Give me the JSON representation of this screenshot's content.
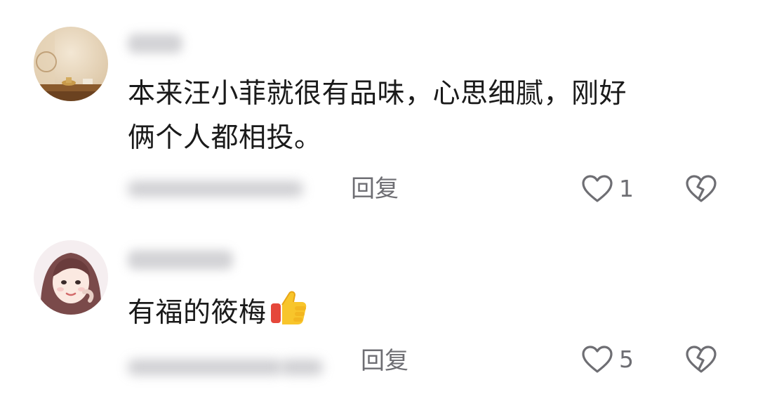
{
  "comments": [
    {
      "text_line1": "本来汪小菲就很有品味，心思细腻，刚好",
      "text_line2": "俩个人都相投。",
      "reply_label": "回复",
      "like_count": "1"
    },
    {
      "text": "有福的筱梅",
      "emoji": "thumbs-up",
      "reply_label": "回复",
      "like_count": "5"
    }
  ],
  "icons": {
    "like": "heart-outline-icon",
    "dislike": "broken-heart-icon",
    "thumb": "thumbs-up-emoji"
  },
  "colors": {
    "text": "#1a1a1a",
    "secondary": "#6e6e73",
    "background": "#ffffff"
  }
}
